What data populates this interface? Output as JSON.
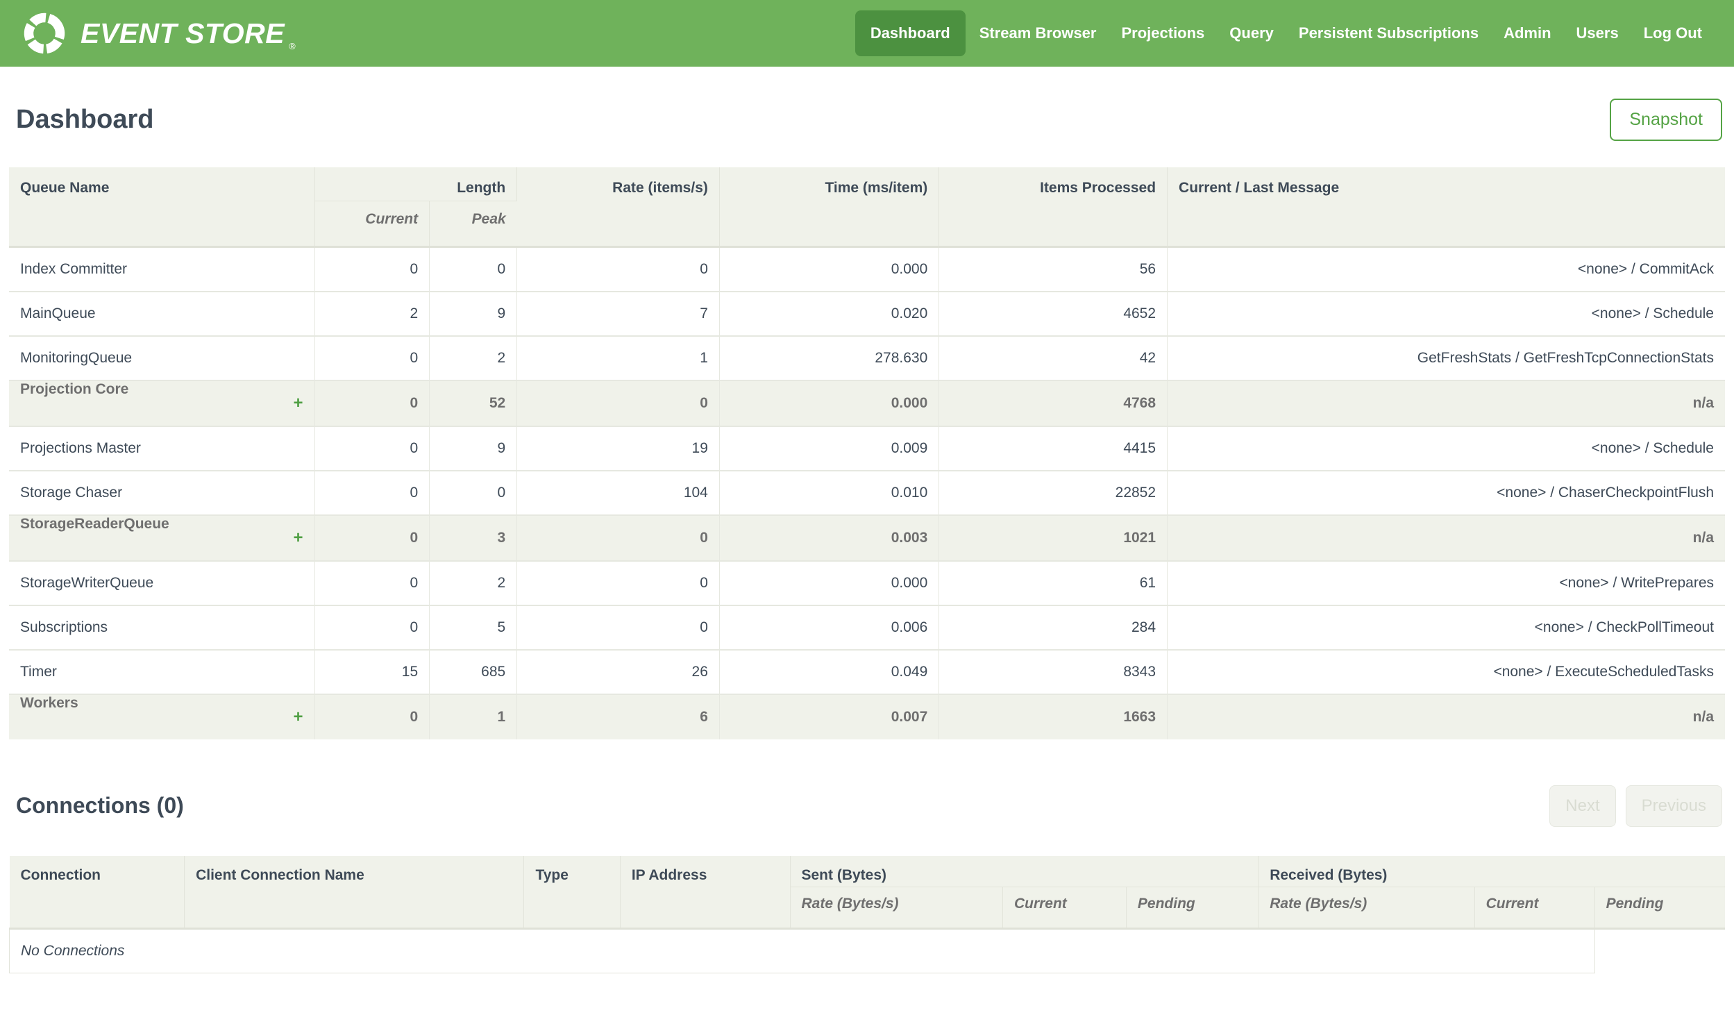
{
  "nav": {
    "brand": "EVENT STORE",
    "brand_mark": "®",
    "items": [
      {
        "label": "Dashboard",
        "active": true
      },
      {
        "label": "Stream Browser",
        "active": false
      },
      {
        "label": "Projections",
        "active": false
      },
      {
        "label": "Query",
        "active": false
      },
      {
        "label": "Persistent Subscriptions",
        "active": false
      },
      {
        "label": "Admin",
        "active": false
      },
      {
        "label": "Users",
        "active": false
      },
      {
        "label": "Log Out",
        "active": false
      }
    ]
  },
  "page": {
    "title": "Dashboard",
    "snapshot_label": "Snapshot"
  },
  "queues": {
    "headers": {
      "queue_name": "Queue Name",
      "length": "Length",
      "current": "Current",
      "peak": "Peak",
      "rate": "Rate (items/s)",
      "time": "Time (ms/item)",
      "items_processed": "Items Processed",
      "message": "Current / Last Message"
    },
    "rows": [
      {
        "name": "Index Committer",
        "group": false,
        "current": "0",
        "peak": "0",
        "rate": "0",
        "time": "0.000",
        "items": "56",
        "message": "<none> / CommitAck"
      },
      {
        "name": "MainQueue",
        "group": false,
        "current": "2",
        "peak": "9",
        "rate": "7",
        "time": "0.020",
        "items": "4652",
        "message": "<none> / Schedule"
      },
      {
        "name": "MonitoringQueue",
        "group": false,
        "current": "0",
        "peak": "2",
        "rate": "1",
        "time": "278.630",
        "items": "42",
        "message": "GetFreshStats / GetFreshTcpConnectionStats"
      },
      {
        "name": "Projection Core",
        "group": true,
        "current": "0",
        "peak": "52",
        "rate": "0",
        "time": "0.000",
        "items": "4768",
        "message": "n/a"
      },
      {
        "name": "Projections Master",
        "group": false,
        "current": "0",
        "peak": "9",
        "rate": "19",
        "time": "0.009",
        "items": "4415",
        "message": "<none> / Schedule"
      },
      {
        "name": "Storage Chaser",
        "group": false,
        "current": "0",
        "peak": "0",
        "rate": "104",
        "time": "0.010",
        "items": "22852",
        "message": "<none> / ChaserCheckpointFlush"
      },
      {
        "name": "StorageReaderQueue",
        "group": true,
        "current": "0",
        "peak": "3",
        "rate": "0",
        "time": "0.003",
        "items": "1021",
        "message": "n/a"
      },
      {
        "name": "StorageWriterQueue",
        "group": false,
        "current": "0",
        "peak": "2",
        "rate": "0",
        "time": "0.000",
        "items": "61",
        "message": "<none> / WritePrepares"
      },
      {
        "name": "Subscriptions",
        "group": false,
        "current": "0",
        "peak": "5",
        "rate": "0",
        "time": "0.006",
        "items": "284",
        "message": "<none> / CheckPollTimeout"
      },
      {
        "name": "Timer",
        "group": false,
        "current": "15",
        "peak": "685",
        "rate": "26",
        "time": "0.049",
        "items": "8343",
        "message": "<none> / ExecuteScheduledTasks"
      },
      {
        "name": "Workers",
        "group": true,
        "current": "0",
        "peak": "1",
        "rate": "6",
        "time": "0.007",
        "items": "1663",
        "message": "n/a"
      }
    ],
    "expand_glyph": "+"
  },
  "connections": {
    "title": "Connections (0)",
    "next_label": "Next",
    "previous_label": "Previous",
    "headers": {
      "connection": "Connection",
      "client_name": "Client Connection Name",
      "type": "Type",
      "ip": "IP Address",
      "sent": "Sent (Bytes)",
      "received": "Received (Bytes)",
      "rate": "Rate (Bytes/s)",
      "current": "Current",
      "pending": "Pending"
    },
    "empty_text": "No Connections"
  },
  "colors": {
    "nav_green": "#6fb25b",
    "nav_active_green": "#4c9140",
    "accent_green": "#4f9f43",
    "snapshot_green": "#55a345",
    "heading_text": "#3e4a57",
    "group_row_text": "#6f6f6f",
    "table_header_bg": "#f0f2ea",
    "table_border": "#e6e8e0"
  }
}
